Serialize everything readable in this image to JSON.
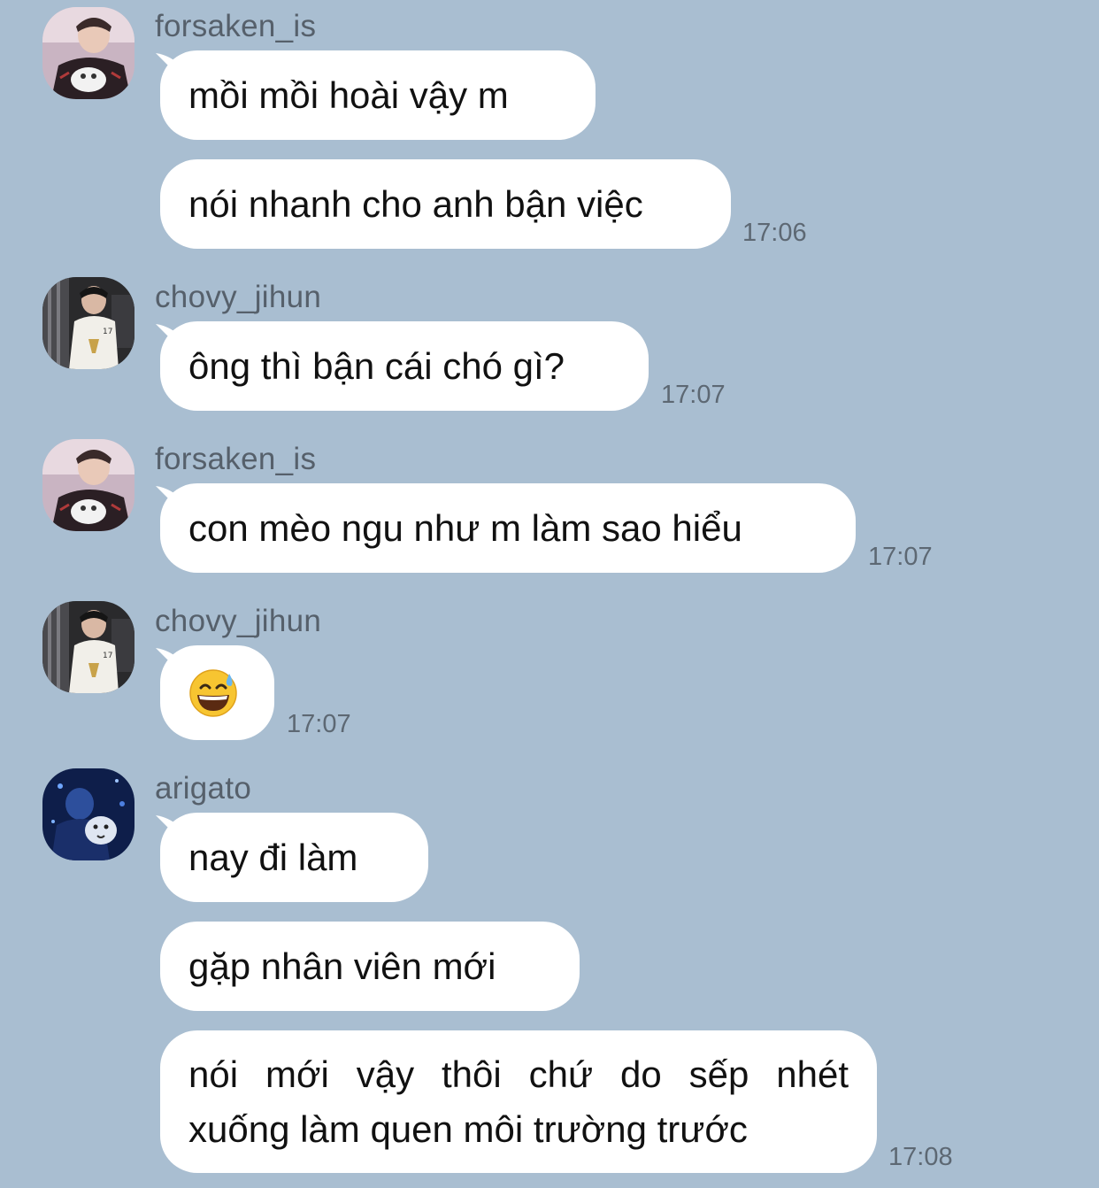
{
  "colors": {
    "background": "#a9bed1",
    "bubble": "#ffffff",
    "sender_text": "#56606b",
    "time_text": "#5d6873"
  },
  "messages": [
    {
      "sender": "forsaken_is",
      "avatar": "avatar-photo-icon",
      "texts": [
        "mồi mồi hoài vậy m",
        "nói nhanh cho anh bận việc"
      ],
      "time": "17:06"
    },
    {
      "sender": "chovy_jihun",
      "avatar": "avatar-photo-icon",
      "texts": [
        "ông thì bận cái chó gì?"
      ],
      "time": "17:07"
    },
    {
      "sender": "forsaken_is",
      "avatar": "avatar-photo-icon",
      "texts": [
        "con mèo ngu như m làm sao hiểu"
      ],
      "time": "17:07"
    },
    {
      "sender": "chovy_jihun",
      "avatar": "avatar-photo-icon",
      "emoji": "grinning-sweat-emoji-icon",
      "time": "17:07"
    },
    {
      "sender": "arigato",
      "avatar": "avatar-photo-icon",
      "texts": [
        "nay đi làm",
        "gặp nhân viên mới",
        "nói mới vậy thôi chứ do sếp nhét",
        "xuống làm quen môi trường trước"
      ],
      "time": "17:08"
    }
  ]
}
